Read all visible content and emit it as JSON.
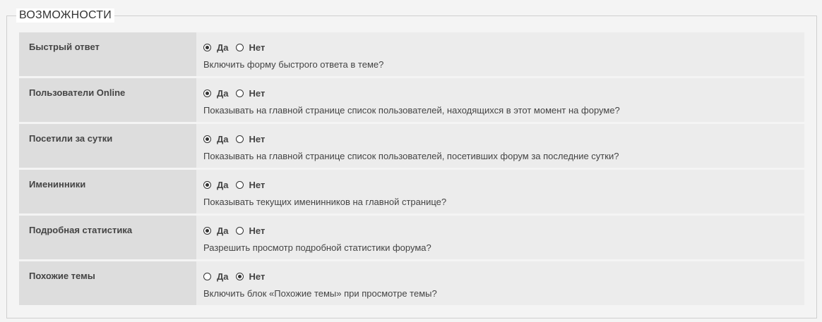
{
  "section": {
    "legend": "ВОЗМОЖНОСТИ"
  },
  "options": {
    "yes": "Да",
    "no": "Нет"
  },
  "rows": [
    {
      "label": "Быстрый ответ",
      "desc": "Включить форму быстрого ответа в теме?",
      "selected": "yes"
    },
    {
      "label": "Пользователи Online",
      "desc": "Показывать на главной странице список пользователей, находящихся в этот момент на форуме?",
      "selected": "yes"
    },
    {
      "label": "Посетили за сутки",
      "desc": "Показывать на главной странице список пользователей, посетивших форум за последние сутки?",
      "selected": "yes"
    },
    {
      "label": "Именинники",
      "desc": "Показывать текущих именинников на главной странице?",
      "selected": "yes"
    },
    {
      "label": "Подробная статистика",
      "desc": "Разрешить просмотр подробной статистики форума?",
      "selected": "yes"
    },
    {
      "label": "Похожие темы",
      "desc": "Включить блок «Похожие темы» при просмотре темы?",
      "selected": "no"
    }
  ]
}
